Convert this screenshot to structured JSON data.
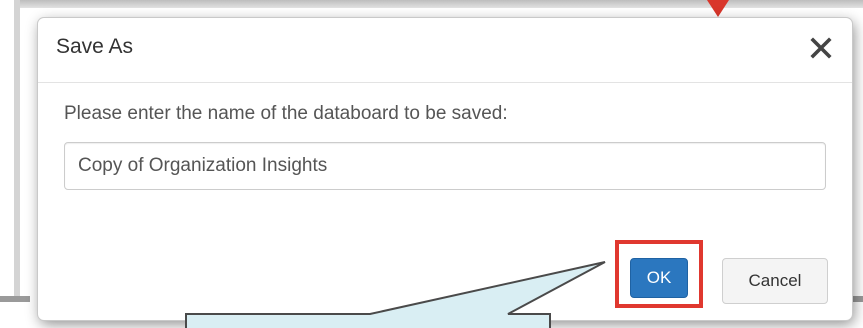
{
  "dialog": {
    "title": "Save As",
    "prompt": "Please enter the name of the databoard to be saved:",
    "name_value": "Copy of Organization Insights",
    "ok_label": "OK",
    "cancel_label": "Cancel",
    "close_icon": "close-icon"
  },
  "colors": {
    "primary_button": "#2b77bf",
    "highlight": "#e0382f",
    "callout_fill": "#d9eef3"
  }
}
